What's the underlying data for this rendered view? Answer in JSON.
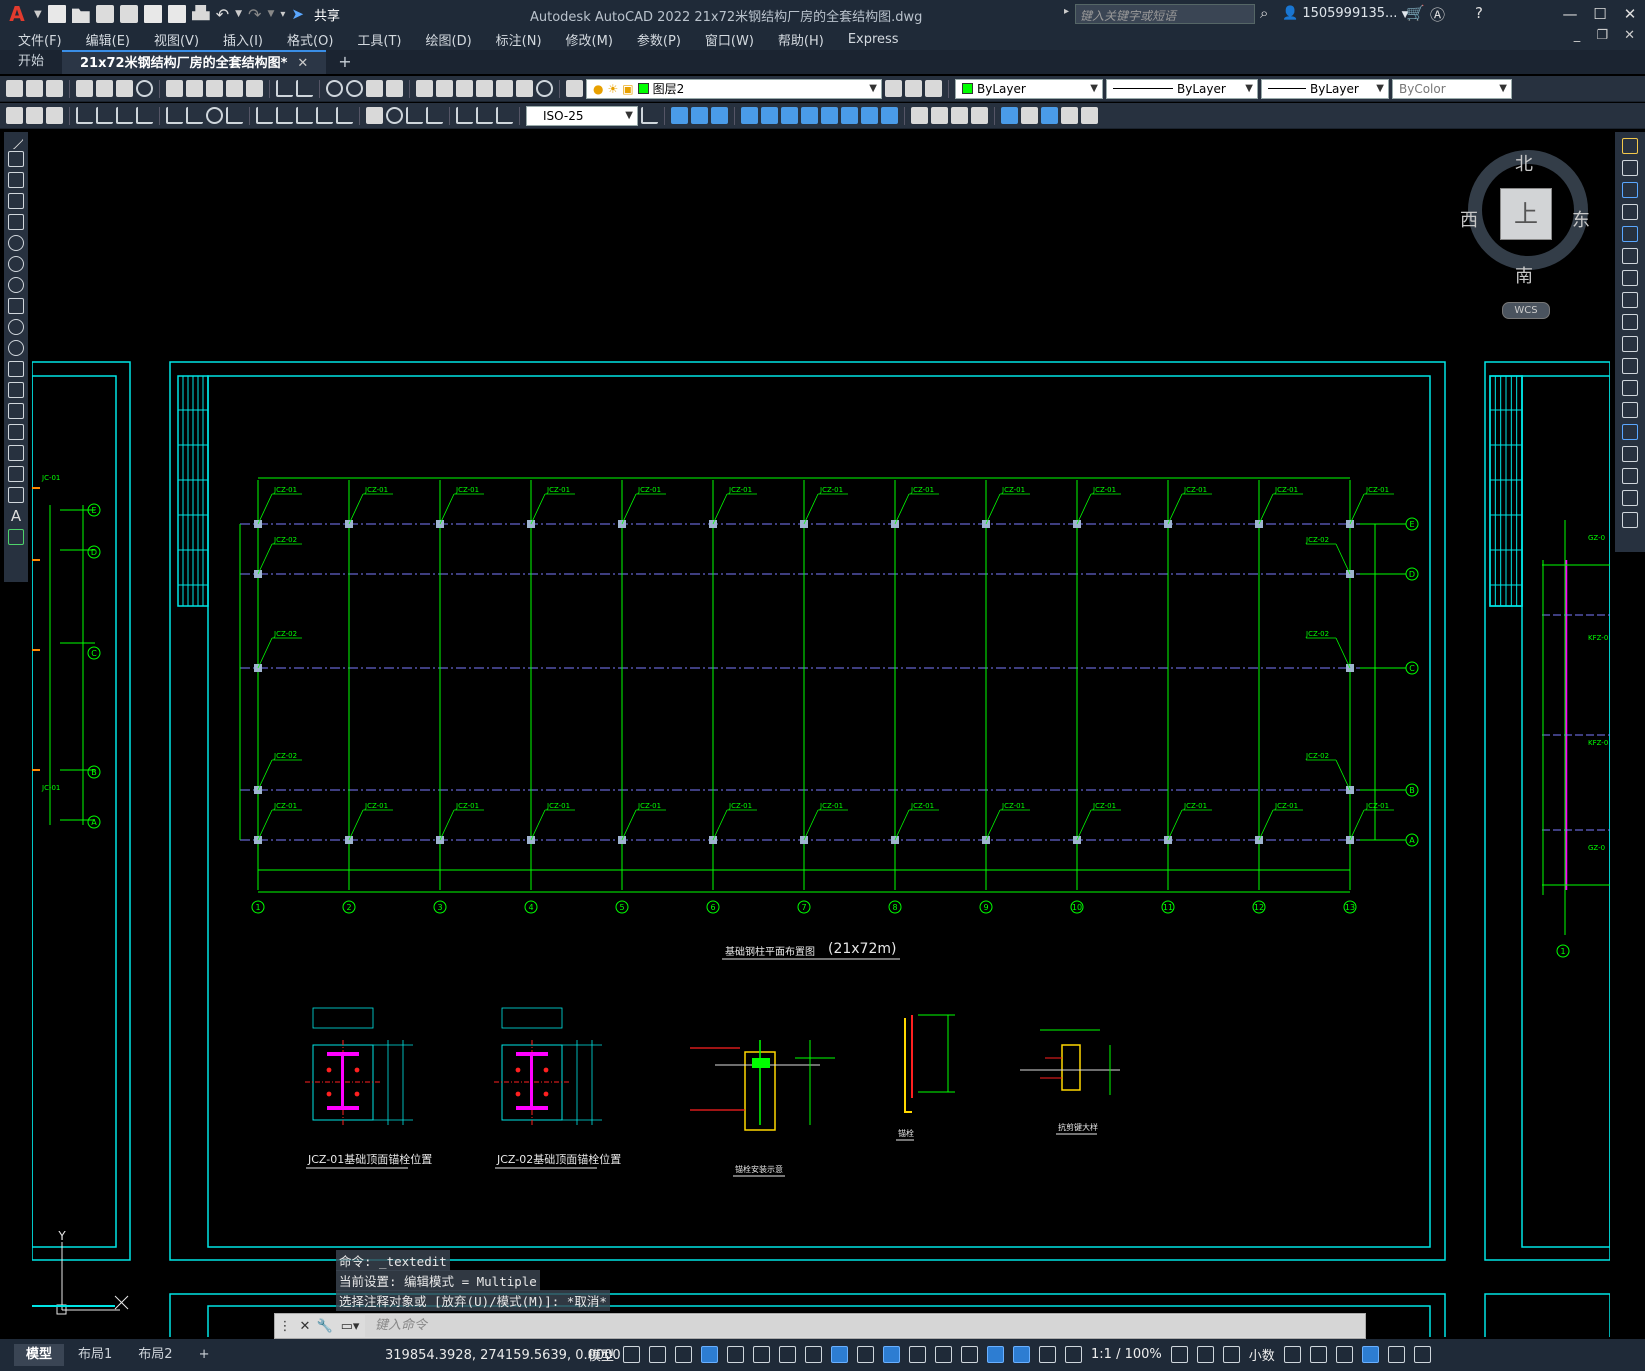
{
  "window": {
    "title": "Autodesk AutoCAD 2022    21x72米钢结构厂房的全套结构图.dwg",
    "search_placeholder": "键入关键字或短语",
    "user": "1505999135...",
    "share_label": "共享",
    "app_logo": "A"
  },
  "menu": [
    "文件(F)",
    "编辑(E)",
    "视图(V)",
    "插入(I)",
    "格式(O)",
    "工具(T)",
    "绘图(D)",
    "标注(N)",
    "修改(M)",
    "参数(P)",
    "窗口(W)",
    "帮助(H)",
    "Express"
  ],
  "tabs": {
    "start": "开始",
    "active": "21x72米钢结构厂房的全套结构图*",
    "close": "✕",
    "plus": "+"
  },
  "properties": {
    "layer": "图层2",
    "color": "ByLayer",
    "linetype": "ByLayer",
    "lineweight": "ByLayer",
    "plotstyle": "ByColor",
    "dimstyle": "ISO-25",
    "layer_swatch_color": "#00ff00"
  },
  "viewcube": {
    "top": "上",
    "north": "北",
    "south": "南",
    "east": "东",
    "west": "西",
    "wcs": "WCS"
  },
  "drawing": {
    "main_title": "基础钢柱平面布置图",
    "main_title_suffix": "(21x72m)",
    "detail1_title": "JCZ-01基础顶面锚栓位置",
    "detail2_title": "JCZ-02基础顶面锚栓位置",
    "detail3_title": "锚栓安装示意",
    "detail4_title": "锚栓",
    "detail5_title": "抗剪键大样",
    "col_tag_1": "JCZ-01",
    "col_tag_2": "JCZ-02",
    "axes_x": [
      "1",
      "2",
      "3",
      "4",
      "5",
      "6",
      "7",
      "8",
      "9",
      "10",
      "11",
      "12",
      "13"
    ],
    "axes_y": [
      "E",
      "D",
      "C",
      "B",
      "A"
    ],
    "side_tag_1": "JC-01",
    "side_tag_2": "JC-01",
    "right_tag_1": "GZ-0",
    "right_tag_2": "KFZ-0",
    "right_tag_3": "KFZ-0",
    "right_tag_4": "GZ-0",
    "ucs_y": "Y"
  },
  "command": {
    "history": [
      "命令:  _textedit",
      "当前设置: 编辑模式 = Multiple",
      "选择注释对象或 [放弃(U)/模式(M)]: *取消*"
    ],
    "placeholder": "键入命令"
  },
  "status": {
    "layouts": [
      "模型",
      "布局1",
      "布局2"
    ],
    "layout_plus": "+",
    "coords": "319854.3928, 274159.5639, 0.0000",
    "model": "模型",
    "scale": "1:1 / 100%",
    "units": "小数"
  },
  "colors": {
    "frame": "#00e5e5",
    "grid_green": "#00ff00",
    "axis_blue": "#7b7bff",
    "column": "#9fb4d0",
    "magenta": "#ff00ff",
    "red": "#ff2020",
    "yellow": "#ffd700",
    "orange": "#ff8a00"
  }
}
